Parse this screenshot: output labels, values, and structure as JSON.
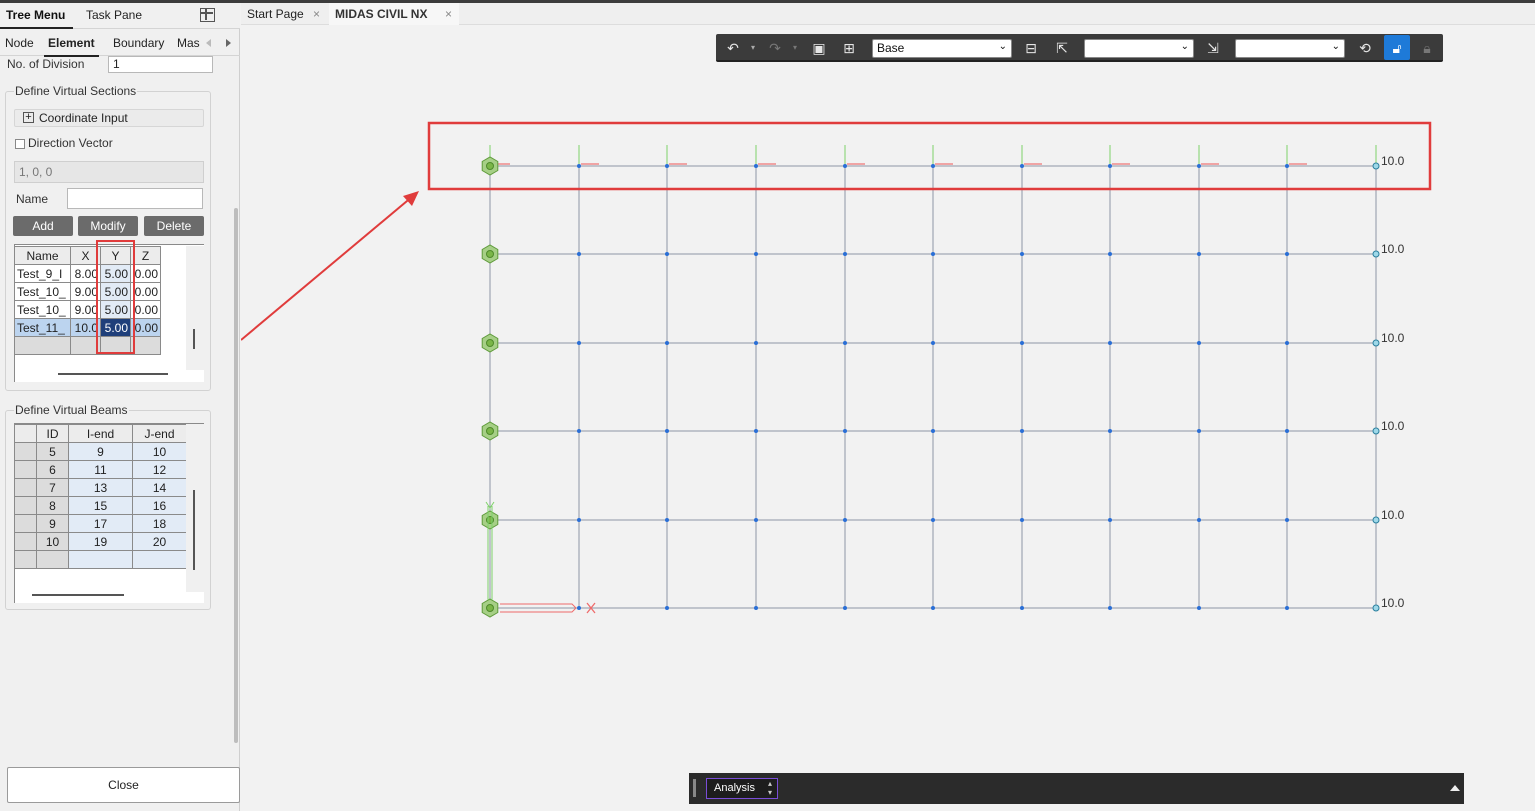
{
  "left_panel": {
    "tabs": [
      "Tree Menu",
      "Task Pane"
    ],
    "sub_tabs": [
      "Node",
      "Element",
      "Boundary",
      "Mas"
    ],
    "no_of_division_label": "No. of Division",
    "no_of_division_value": "1",
    "virtual_sections_title": "Define Virtual Sections",
    "coordinate_input_label": "Coordinate Input",
    "direction_vector_label": "Direction Vector",
    "direction_vector_value": "1, 0, 0",
    "name_label": "Name",
    "name_value": "",
    "buttons": {
      "add": "Add",
      "modify": "Modify",
      "delete": "Delete"
    },
    "sections_table": {
      "headers": [
        "Name",
        "X",
        "Y",
        "Z"
      ],
      "rows": [
        [
          "Test_9_I",
          "8.00",
          "5.00",
          "0.00"
        ],
        [
          "Test_10_",
          "9.00",
          "5.00",
          "0.00"
        ],
        [
          "Test_10_",
          "9.00",
          "5.00",
          "0.00"
        ],
        [
          "Test_11_",
          "10.0",
          "5.00",
          "0.00"
        ]
      ]
    },
    "virtual_beams_title": "Define Virtual Beams",
    "beams_table": {
      "headers": [
        "ID",
        "I-end",
        "J-end"
      ],
      "rows": [
        [
          "5",
          "9",
          "10"
        ],
        [
          "6",
          "11",
          "12"
        ],
        [
          "7",
          "13",
          "14"
        ],
        [
          "8",
          "15",
          "16"
        ],
        [
          "9",
          "17",
          "18"
        ],
        [
          "10",
          "19",
          "20"
        ]
      ]
    },
    "close_label": "Close"
  },
  "doc_tabs": [
    "Start Page",
    "MIDAS CIVIL NX"
  ],
  "toolbar": {
    "select_base": "Base",
    "select_2": "",
    "select_3": ""
  },
  "viewport": {
    "row_labels": [
      "10.0",
      "10.0",
      "10.0",
      "10.0",
      "10.0",
      "10.0"
    ],
    "highlight_color": "#e03c3c",
    "node_color": "#2a6fd6",
    "support_color": "#7ab648"
  },
  "statusbar": {
    "mode": "Analysis"
  }
}
